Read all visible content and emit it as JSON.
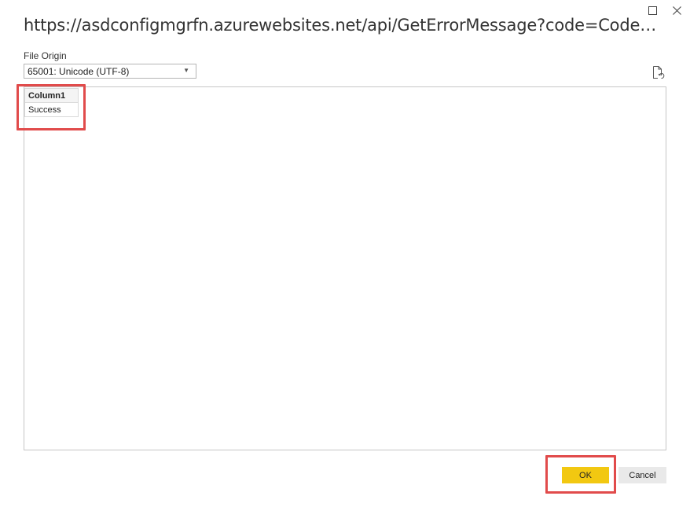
{
  "window": {
    "title": "https://asdconfigmgrfn.azurewebsites.net/api/GetErrorMessage?code=Code&Er...",
    "maximize_icon": "maximize-icon",
    "close_icon": "close-icon"
  },
  "file_origin": {
    "label": "File Origin",
    "selected": "65001: Unicode (UTF-8)"
  },
  "preview": {
    "refresh_icon": "refresh-file-icon",
    "columns": [
      "Column1"
    ],
    "rows": [
      [
        "Success"
      ]
    ]
  },
  "footer": {
    "ok_label": "OK",
    "cancel_label": "Cancel"
  },
  "colors": {
    "ok_button": "#f2c811",
    "highlight": "#e14b4b",
    "cancel_button": "#e9e9e9"
  }
}
